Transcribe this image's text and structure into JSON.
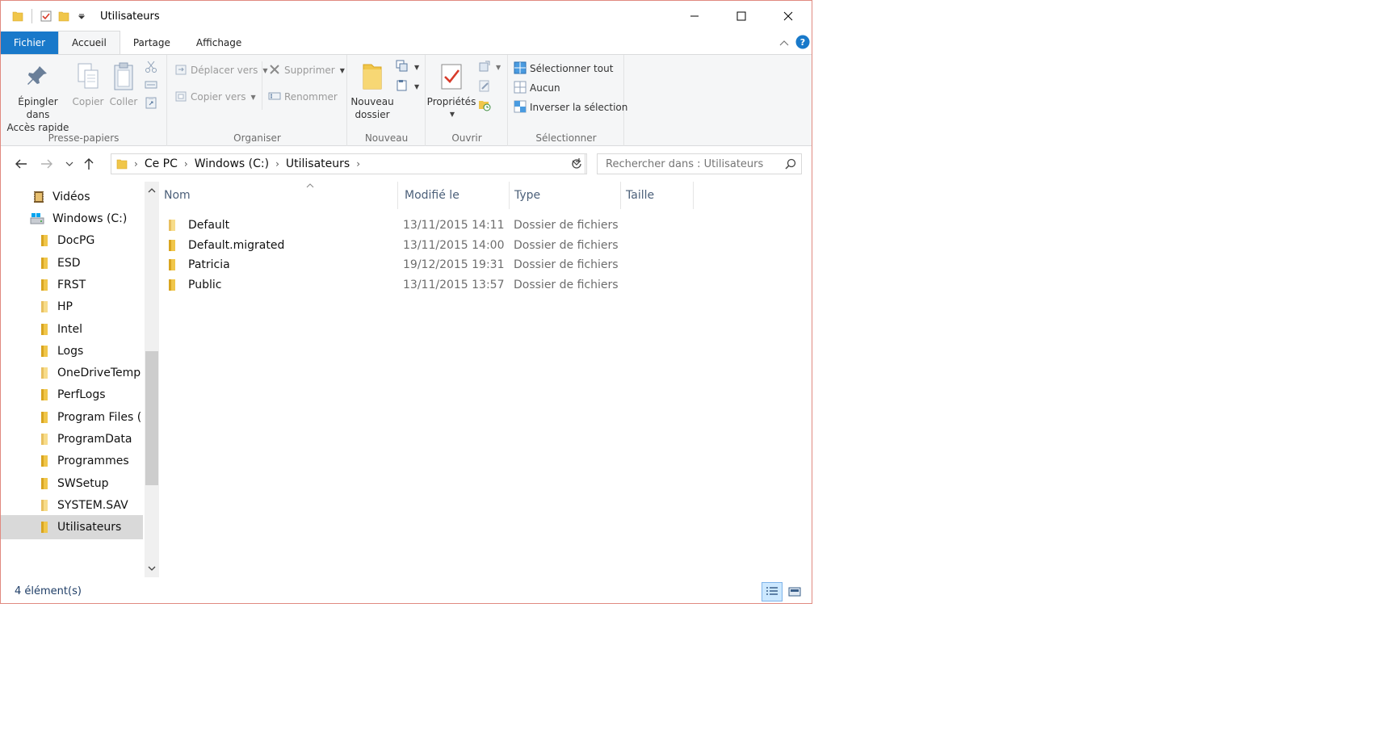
{
  "window": {
    "title": "Utilisateurs",
    "controls": [
      "minimize",
      "maximize",
      "close"
    ]
  },
  "ribbon_tabs": [
    {
      "label": "Fichier"
    },
    {
      "label": "Accueil"
    },
    {
      "label": "Partage"
    },
    {
      "label": "Affichage"
    }
  ],
  "ribbon": {
    "presse_papiers": {
      "label": "Presse-papiers",
      "pin_line1": "Épingler dans",
      "pin_line2": "Accès rapide",
      "copy": "Copier",
      "paste": "Coller"
    },
    "organiser": {
      "label": "Organiser",
      "move_to": "Déplacer vers",
      "copy_to": "Copier vers",
      "delete": "Supprimer",
      "rename": "Renommer"
    },
    "nouveau": {
      "label": "Nouveau",
      "new_folder_line1": "Nouveau",
      "new_folder_line2": "dossier"
    },
    "ouvrir": {
      "label": "Ouvrir",
      "properties": "Propriétés"
    },
    "selectionner": {
      "label": "Sélectionner",
      "select_all": "Sélectionner tout",
      "select_none": "Aucun",
      "invert": "Inverser la sélection"
    }
  },
  "address": {
    "crumbs": [
      "Ce PC",
      "Windows (C:)",
      "Utilisateurs"
    ]
  },
  "search": {
    "placeholder": "Rechercher dans : Utilisateurs"
  },
  "tree": [
    {
      "label": "Vidéos",
      "icon": "videos-icon"
    },
    {
      "label": "Windows (C:)",
      "icon": "drive-icon"
    },
    {
      "label": "DocPG",
      "icon": "folder-icon"
    },
    {
      "label": "ESD",
      "icon": "folder-icon"
    },
    {
      "label": "FRST",
      "icon": "folder-icon"
    },
    {
      "label": "HP",
      "icon": "folder-icon"
    },
    {
      "label": "Intel",
      "icon": "folder-icon"
    },
    {
      "label": "Logs",
      "icon": "folder-icon"
    },
    {
      "label": "OneDriveTemp",
      "icon": "folder-icon"
    },
    {
      "label": "PerfLogs",
      "icon": "folder-icon"
    },
    {
      "label": "Program Files (",
      "icon": "folder-icon"
    },
    {
      "label": "ProgramData",
      "icon": "folder-icon"
    },
    {
      "label": "Programmes",
      "icon": "folder-icon"
    },
    {
      "label": "SWSetup",
      "icon": "folder-icon"
    },
    {
      "label": "SYSTEM.SAV",
      "icon": "folder-icon"
    },
    {
      "label": "Utilisateurs",
      "icon": "folder-icon",
      "selected": true
    }
  ],
  "columns": [
    "Nom",
    "Modifié le",
    "Type",
    "Taille"
  ],
  "files": [
    {
      "name": "Default",
      "modified": "13/11/2015 14:11",
      "type": "Dossier de fichiers"
    },
    {
      "name": "Default.migrated",
      "modified": "13/11/2015 14:00",
      "type": "Dossier de fichiers"
    },
    {
      "name": "Patricia",
      "modified": "19/12/2015 19:31",
      "type": "Dossier de fichiers"
    },
    {
      "name": "Public",
      "modified": "13/11/2015 13:57",
      "type": "Dossier de fichiers"
    }
  ],
  "status": {
    "count": "4 élément(s)"
  },
  "colors": {
    "file_tab": "#1979ca",
    "folder": "#f0c64a",
    "header_text": "#4c607a",
    "selection": "#d9d9d9"
  }
}
